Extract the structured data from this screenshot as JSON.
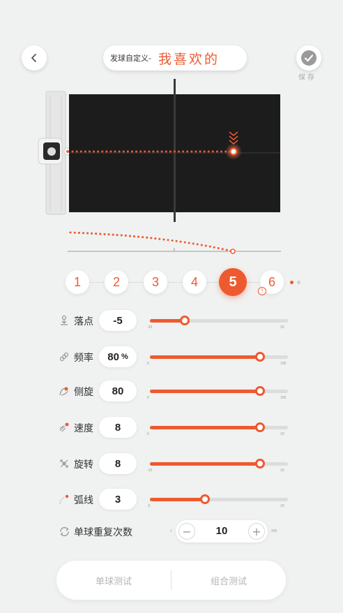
{
  "header": {
    "title_prefix": "发球自定义-",
    "title_name": "我喜欢的",
    "save_label": "保存"
  },
  "balls": {
    "items": [
      "1",
      "2",
      "3",
      "4",
      "5",
      "6"
    ],
    "active_index": 4,
    "warning_index": 5
  },
  "params": {
    "landing": {
      "label": "落点",
      "value": "-5",
      "min": "-10",
      "max": "10",
      "level": 0.25
    },
    "frequency": {
      "label": "频率",
      "value": "80",
      "unit": "%",
      "min": "0",
      "max": "100",
      "level": 0.8
    },
    "side_spin": {
      "label": "侧旋",
      "value": "80",
      "min": "0",
      "max": "100",
      "level": 0.8
    },
    "speed": {
      "label": "速度",
      "value": "8",
      "min": "0",
      "max": "10",
      "level": 0.8
    },
    "spin": {
      "label": "旋转",
      "value": "8",
      "min": "-10",
      "max": "10",
      "level": 0.8
    },
    "arc": {
      "label": "弧线",
      "value": "3",
      "min": "-5",
      "max": "10",
      "level": 0.4
    }
  },
  "repeat": {
    "label": "单球重复次数",
    "value": "10",
    "min": "1",
    "max": "200",
    "minus": "−",
    "plus": "+"
  },
  "bottom": {
    "single_test": "单球测试",
    "combo_test": "组合测试"
  },
  "colors": {
    "accent": "#ee5a2f",
    "table": "#1c1c1c",
    "track": "#dcdcdc"
  }
}
